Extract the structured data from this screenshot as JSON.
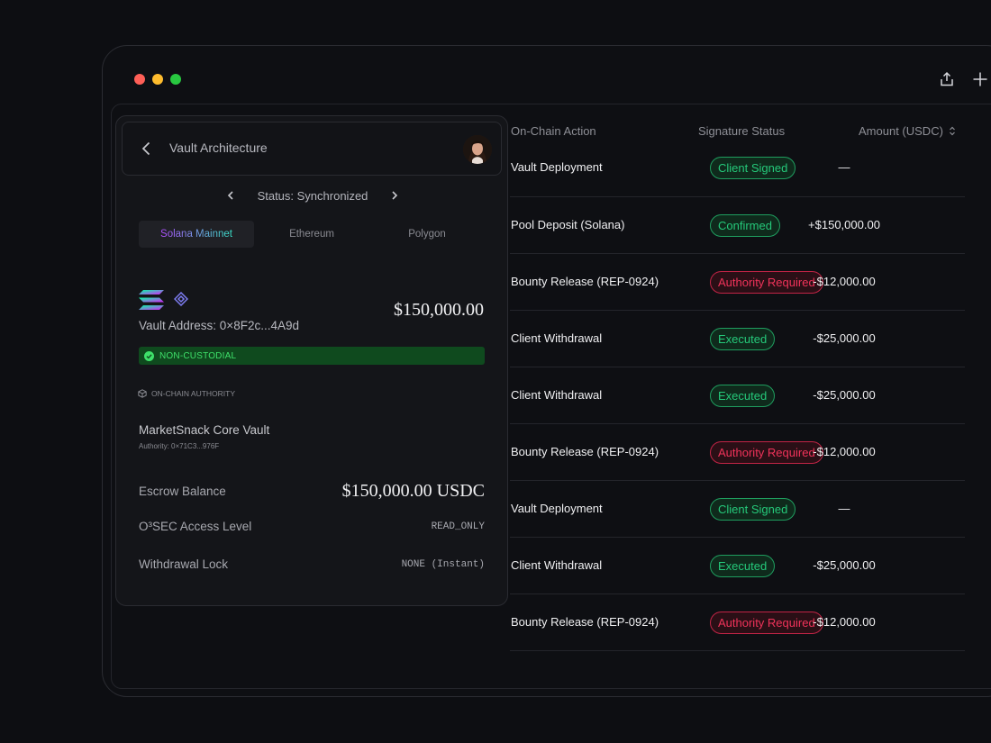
{
  "window": {
    "traffic": [
      "close",
      "minimize",
      "maximize"
    ],
    "toolbar_icons": [
      "share-icon",
      "plus-icon"
    ]
  },
  "panel": {
    "title": "Vault Architecture",
    "status": "Status: Synchronized",
    "tabs": [
      {
        "label": "Solana Mainnet",
        "active": true
      },
      {
        "label": "Ethereum",
        "active": false
      },
      {
        "label": "Polygon",
        "active": false
      }
    ],
    "vault_address": "Vault Address: 0×8F2c...4A9d",
    "vault_amount": "$150,000.00",
    "badge": "NON-CUSTODIAL",
    "authority_label": "ON-CHAIN AUTHORITY",
    "vault_name": "MarketSnack Core Vault",
    "vault_authority": "Authority: 0×71C3...976F",
    "escrow_label": "Escrow Balance",
    "escrow_value": "$150,000.00 USDC",
    "access_label": "O³SEC Access Level",
    "access_value": "READ_ONLY",
    "lock_label": "Withdrawal Lock",
    "lock_value": "NONE (Instant)"
  },
  "table": {
    "headers": {
      "action": "On-Chain Action",
      "status": "Signature Status",
      "amount": "Amount (USDC)"
    },
    "rows": [
      {
        "action": "Vault Deployment",
        "status": "Client Signed",
        "tone": "green",
        "amount": "—"
      },
      {
        "action": "Pool Deposit (Solana)",
        "status": "Confirmed",
        "tone": "green",
        "amount": "+$150,000.00"
      },
      {
        "action": "Bounty Release (REP-0924)",
        "status": "Authority Required",
        "tone": "red",
        "amount": "-$12,000.00"
      },
      {
        "action": "Client Withdrawal",
        "status": "Executed",
        "tone": "green",
        "amount": "-$25,000.00"
      },
      {
        "action": "Client Withdrawal",
        "status": "Executed",
        "tone": "green",
        "amount": "-$25,000.00"
      },
      {
        "action": "Bounty Release (REP-0924)",
        "status": "Authority Required",
        "tone": "red",
        "amount": "-$12,000.00"
      },
      {
        "action": "Vault Deployment",
        "status": "Client Signed",
        "tone": "green",
        "amount": "—"
      },
      {
        "action": "Client Withdrawal",
        "status": "Executed",
        "tone": "green",
        "amount": "-$25,000.00"
      },
      {
        "action": "Bounty Release (REP-0924)",
        "status": "Authority Required",
        "tone": "red",
        "amount": "-$12,000.00"
      }
    ]
  },
  "colors": {
    "success": "#25c97a",
    "danger": "#f0335a",
    "badge_bg": "#0f4a1e"
  }
}
